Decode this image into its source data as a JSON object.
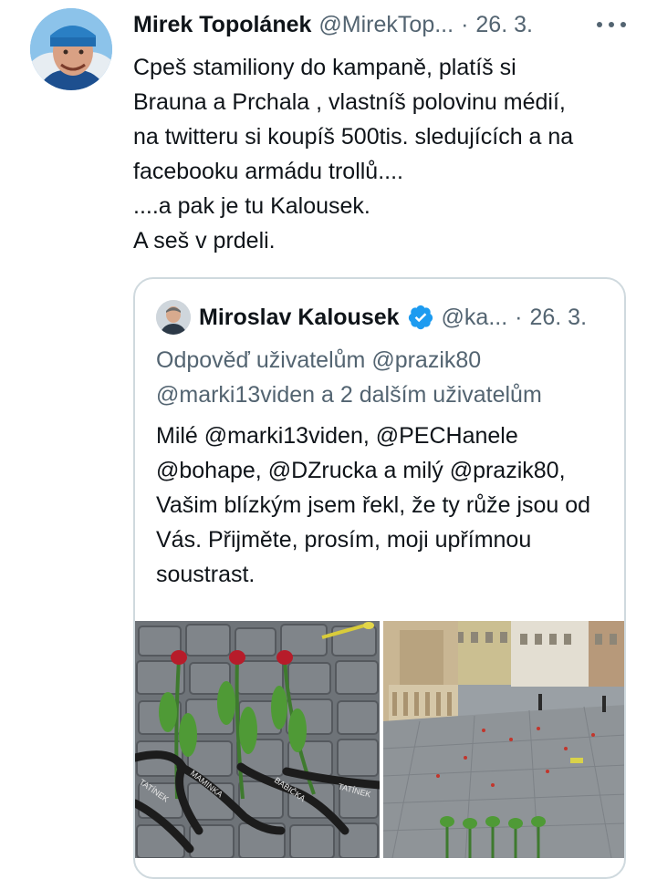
{
  "tweet": {
    "author_name": "Mirek Topolánek",
    "author_handle": "@MirekTop...",
    "separator": "·",
    "date": "26. 3.",
    "more_icon": "more-horizontal-icon",
    "text": "Cpeš stamiliony do kampaně, platíš si\nBrauna a Prchala , vlastníš polovinu médií,\nna twitteru si koupíš 500tis. sledujících a na\nfacebooku armádu trollů....\n....a pak je tu Kalousek.\nA seš v prdeli."
  },
  "quoted_tweet": {
    "author_name": "Miroslav Kalousek",
    "author_handle": "@ka...",
    "separator": "·",
    "date": "26. 3.",
    "verified_icon": "verified-badge-icon",
    "reply_prefix": "Odpověď uživatelům ",
    "reply_mention_1": "@prazik80",
    "reply_mention_2": "@marki13viden",
    "reply_suffix": "  a 2 dalším uživatelům",
    "text": "Milé @marki13viden, @PECHanele @bohape, @DZrucka a milý @prazik80, Vašim blízkým jsem řekl, že ty růže jsou od Vás. Přijměte, prosím, moji upřímnou soustrast.",
    "photo_left_ribbon_labels": [
      "TATÍNEK",
      "MAMINKA",
      "BABIČKA",
      "TATÍNEK"
    ]
  },
  "colors": {
    "text": "#0f1419",
    "secondary": "#536471",
    "border": "#cfd9de",
    "verified": "#1d9bf0"
  }
}
